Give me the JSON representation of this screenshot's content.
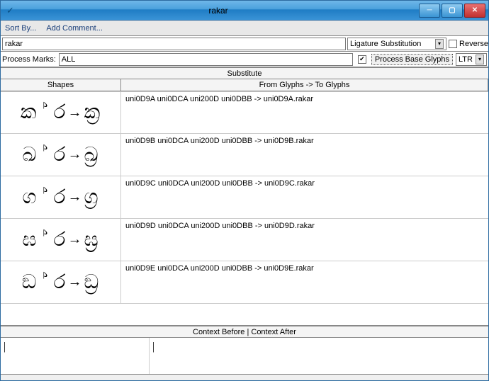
{
  "window": {
    "title": "rakar"
  },
  "menu": {
    "sort": "Sort By...",
    "comment": "Add Comment..."
  },
  "toolbar": {
    "name_value": "rakar",
    "lookup_type": "Ligature Substitution",
    "reverse_label": "Reverse",
    "process_marks_label": "Process Marks:",
    "process_marks_value": "ALL",
    "process_base_label": "Process Base Glyphs",
    "direction": "LTR"
  },
  "headers": {
    "substitute": "Substitute",
    "shapes": "Shapes",
    "glyphs": "From Glyphs -> To Glyphs",
    "context": "Context Before | Context After"
  },
  "rows": [
    {
      "shape_src": "ක ්  ර",
      "shape_dst": "ක්‍ර",
      "text": "uni0D9A uni0DCA uni200D uni0DBB -> uni0D9A.rakar"
    },
    {
      "shape_src": "ඛ ්  ර",
      "shape_dst": "ඛ්‍ර",
      "text": "uni0D9B uni0DCA uni200D uni0DBB -> uni0D9B.rakar"
    },
    {
      "shape_src": "ග ්  ර",
      "shape_dst": "ග්‍ර",
      "text": "uni0D9C uni0DCA uni200D uni0DBB -> uni0D9C.rakar"
    },
    {
      "shape_src": "ඝ ්  ර",
      "shape_dst": "ඝ්‍ර",
      "text": "uni0D9D uni0DCA uni200D uni0DBB -> uni0D9D.rakar"
    },
    {
      "shape_src": "ඞ ්  ර",
      "shape_dst": "ඞ්‍ර",
      "text": "uni0D9E uni0DCA uni200D uni0DBB -> uni0D9E.rakar"
    }
  ],
  "context": {
    "before": "|",
    "after": "|"
  }
}
